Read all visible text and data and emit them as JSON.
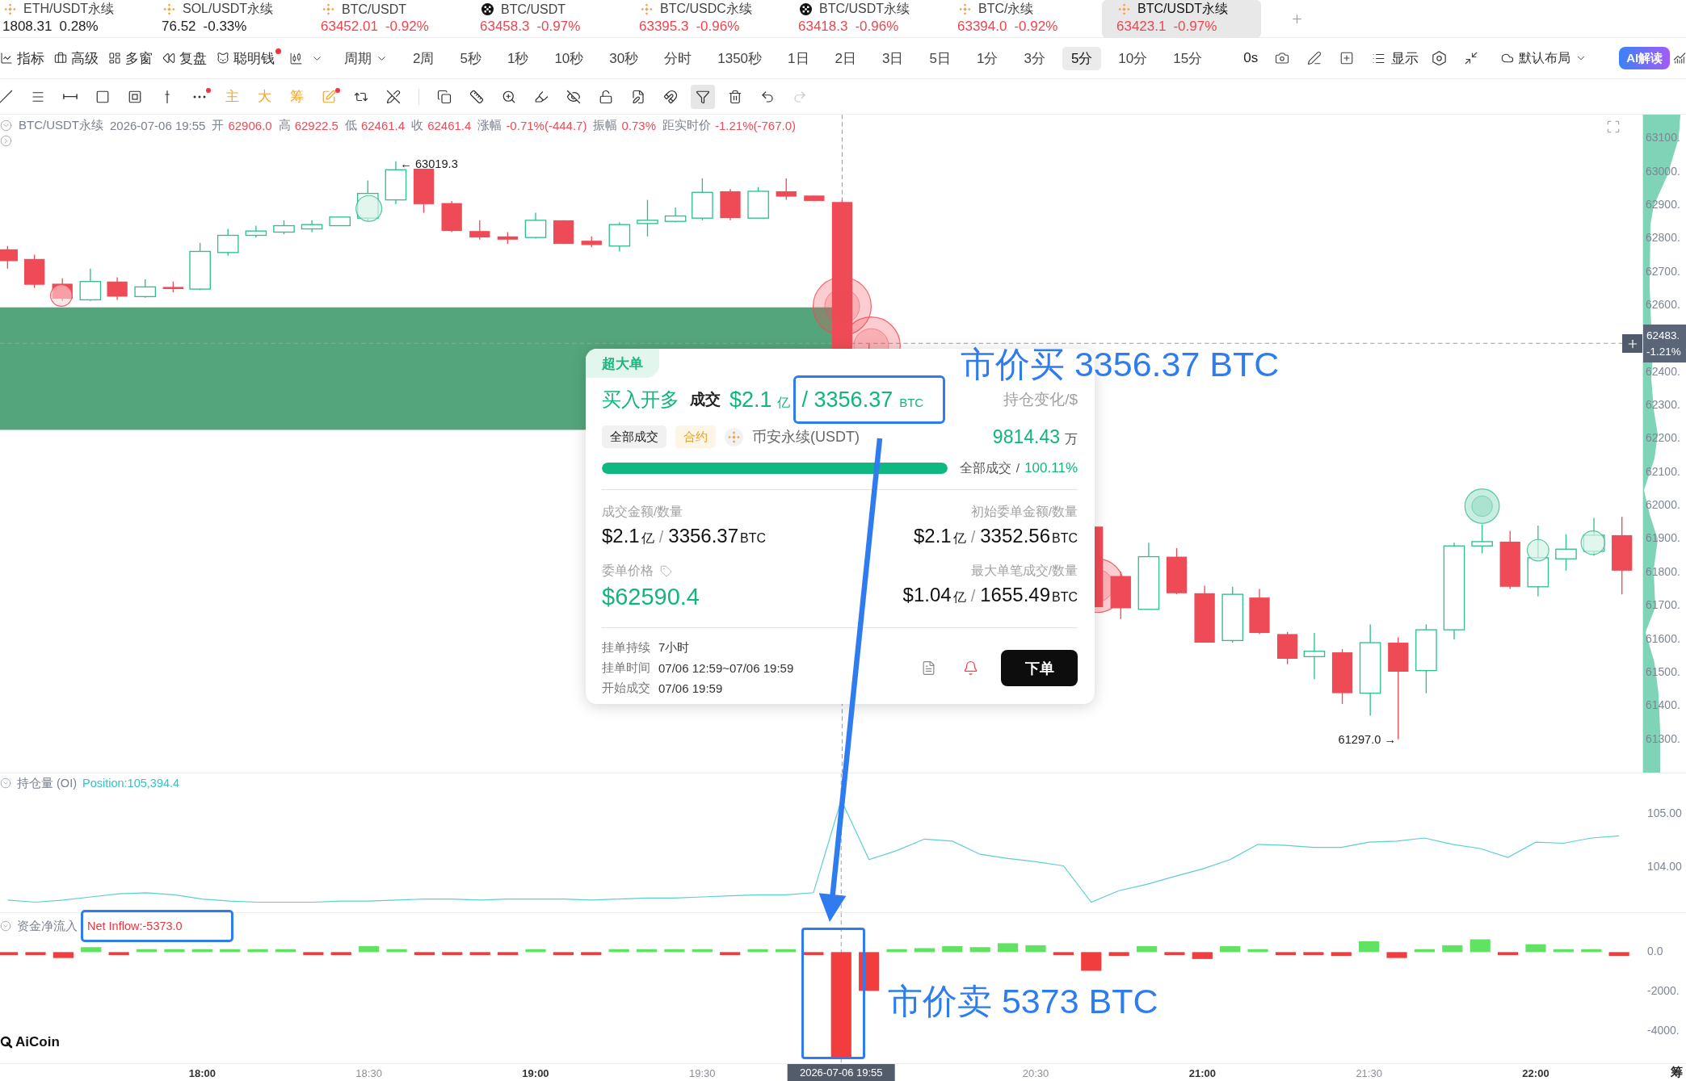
{
  "tickers": [
    {
      "symbol": "ETH/USDT永续",
      "price": "1808.31",
      "change": "0.28%",
      "kind": "diamond",
      "color": "#222222",
      "selected": false
    },
    {
      "symbol": "SOL/USDT永续",
      "price": "76.52",
      "change": "-0.33%",
      "kind": "diamond",
      "color": "#222222",
      "selected": false
    },
    {
      "symbol": "BTC/USDT",
      "price": "63452.01",
      "change": "-0.92%",
      "kind": "diamond",
      "color": "#f0444f",
      "selected": false
    },
    {
      "symbol": "BTC/USDT",
      "price": "63458.3",
      "change": "-0.97%",
      "kind": "checker",
      "color": "#f0444f",
      "selected": false
    },
    {
      "symbol": "BTC/USDC永续",
      "price": "63395.3",
      "change": "-0.96%",
      "kind": "diamond",
      "color": "#f0444f",
      "selected": false
    },
    {
      "symbol": "BTC/USDT永续",
      "price": "63418.3",
      "change": "-0.96%",
      "kind": "checker",
      "color": "#f0444f",
      "selected": false
    },
    {
      "symbol": "BTC/永续",
      "price": "63394.0",
      "change": "-0.92%",
      "kind": "diamond",
      "color": "#f0444f",
      "selected": false
    },
    {
      "symbol": "BTC/USDT永续",
      "price": "63423.1",
      "change": "-0.97%",
      "kind": "diamond",
      "color": "#f0444f",
      "selected": true
    }
  ],
  "toolbar": {
    "items": [
      {
        "label": "指标",
        "dot": false
      },
      {
        "label": "高级",
        "dot": false
      },
      {
        "label": "多窗",
        "dot": false
      },
      {
        "label": "复盘",
        "dot": false
      },
      {
        "label": "聪明钱",
        "dot": true
      }
    ],
    "period_menu": "周期",
    "periods": [
      {
        "label": "2周",
        "selected": false
      },
      {
        "label": "5秒",
        "selected": false
      },
      {
        "label": "1秒",
        "selected": false
      },
      {
        "label": "10秒",
        "selected": false
      },
      {
        "label": "30秒",
        "selected": false
      },
      {
        "label": "分时",
        "selected": false
      },
      {
        "label": "1350秒",
        "selected": false
      },
      {
        "label": "1日",
        "selected": false
      },
      {
        "label": "2日",
        "selected": false
      },
      {
        "label": "3日",
        "selected": false
      },
      {
        "label": "5日",
        "selected": false
      },
      {
        "label": "1分",
        "selected": false
      },
      {
        "label": "3分",
        "selected": false
      },
      {
        "label": "5分",
        "selected": true
      },
      {
        "label": "10分",
        "selected": false
      },
      {
        "label": "15分",
        "selected": false
      }
    ],
    "countdown": "0s",
    "display": "显示",
    "layout": "默认布局",
    "ai_button": "AI解读"
  },
  "drawing_tools": {
    "groups": [
      {
        "items": [
          {
            "kind": "trend-line",
            "selected": false,
            "dot": false,
            "disabled": false
          },
          {
            "kind": "parallel-lines",
            "selected": false,
            "dot": false,
            "disabled": false
          },
          {
            "kind": "horizontal-line",
            "selected": false,
            "dot": false,
            "disabled": false
          },
          {
            "kind": "rectangle",
            "selected": false,
            "dot": false,
            "disabled": false
          },
          {
            "kind": "frame",
            "selected": false,
            "dot": false,
            "disabled": false
          },
          {
            "kind": "vertical-line",
            "selected": false,
            "dot": false,
            "disabled": false
          },
          {
            "kind": "ellipsis",
            "selected": false,
            "dot": true,
            "disabled": false
          },
          {
            "kind": "text",
            "label": "主",
            "selected": false,
            "dot": false,
            "disabled": false
          },
          {
            "kind": "text",
            "label": "大",
            "selected": false,
            "dot": false,
            "disabled": false
          },
          {
            "kind": "text",
            "label": "筹",
            "selected": false,
            "dot": false,
            "disabled": false
          },
          {
            "kind": "pen-square",
            "selected": false,
            "dot": true,
            "disabled": false
          },
          {
            "kind": "repeat",
            "selected": false,
            "dot": false,
            "disabled": false
          },
          {
            "kind": "pen-off",
            "selected": false,
            "dot": false,
            "disabled": false
          }
        ]
      },
      {
        "items": [
          {
            "kind": "copy",
            "selected": false,
            "dot": false,
            "disabled": false
          },
          {
            "kind": "ruler",
            "selected": false,
            "dot": false,
            "disabled": false
          },
          {
            "kind": "zoom-in",
            "selected": false,
            "dot": false,
            "disabled": false
          },
          {
            "kind": "highlighter",
            "selected": false,
            "dot": false,
            "disabled": false
          },
          {
            "kind": "eye-off",
            "selected": false,
            "dot": false,
            "disabled": false
          },
          {
            "kind": "unlock",
            "selected": false,
            "dot": false,
            "disabled": false
          },
          {
            "kind": "file-pen",
            "selected": false,
            "dot": false,
            "disabled": false
          },
          {
            "kind": "magnet",
            "selected": false,
            "dot": false,
            "disabled": false
          },
          {
            "kind": "filter",
            "selected": true,
            "dot": false,
            "disabled": false
          },
          {
            "kind": "trash",
            "selected": false,
            "dot": false,
            "disabled": false
          },
          {
            "kind": "undo",
            "selected": false,
            "dot": false,
            "disabled": false
          },
          {
            "kind": "redo",
            "selected": false,
            "dot": false,
            "disabled": true
          }
        ]
      }
    ]
  },
  "chart": {
    "legend": {
      "symbol": "BTC/USDT永续",
      "time": "2026-07-06 19:55",
      "fields": [
        {
          "label": "开",
          "value": "62906.0"
        },
        {
          "label": "高",
          "value": "62922.5"
        },
        {
          "label": "低",
          "value": "62461.4"
        },
        {
          "label": "收",
          "value": "62461.4"
        },
        {
          "label": "涨幅",
          "value": "-0.71%(-444.7)"
        },
        {
          "label": "振幅",
          "value": "0.73%"
        },
        {
          "label": "距实时价",
          "value": "-1.21%(-767.0)"
        }
      ]
    },
    "high_marker": "← 63019.3",
    "low_marker": "61297.0 →",
    "price_axis": [
      "63100.",
      "63000.",
      "62900.",
      "62800.",
      "62700.",
      "62600.",
      "62400.",
      "62300.",
      "62200.",
      "62100.",
      "62000.",
      "61900.",
      "61800.",
      "61700.",
      "61600.",
      "61500.",
      "61400.",
      "61300."
    ],
    "last_price": {
      "price": "62483.",
      "change": "-1.21%"
    }
  },
  "order_card": {
    "tag": "超大单",
    "side": "买入开多",
    "deal_label": "成交",
    "deal_amount": {
      "value": "$2.1",
      "unit": "亿"
    },
    "deal_quantity": {
      "value": "/ 3356.37",
      "unit": "BTC"
    },
    "position_label": "持仓变化/$",
    "chips": [
      {
        "label": "全部成交",
        "kind": "status"
      },
      {
        "label": "合约",
        "kind": "contract"
      }
    ],
    "exchange": "币安永续(USDT)",
    "position_change": {
      "value": "9814.43",
      "unit": "万"
    },
    "fill": {
      "level": 1,
      "label": "全部成交",
      "separator": "/",
      "percent": "100.11%"
    },
    "stats": [
      {
        "label": "成交金额/数量",
        "kind": "amount",
        "parts": [
          {
            "kind": "number",
            "text": "$2.1"
          },
          {
            "kind": "unit",
            "text": "亿"
          },
          {
            "kind": "slash",
            "text": "/"
          },
          {
            "kind": "number",
            "text": "3356.37"
          },
          {
            "kind": "unit",
            "text": "BTC"
          }
        ]
      },
      {
        "label": "初始委单金额/数量",
        "kind": "amount",
        "parts": [
          {
            "kind": "number",
            "text": "$2.1"
          },
          {
            "kind": "unit",
            "text": "亿"
          },
          {
            "kind": "slash",
            "text": "/"
          },
          {
            "kind": "number",
            "text": "3352.56"
          },
          {
            "kind": "unit",
            "text": "BTC"
          }
        ]
      },
      {
        "label": "委单价格",
        "kind": "price",
        "parts": [
          {
            "kind": "number",
            "text": "$62590.4"
          }
        ]
      },
      {
        "label": "最大单笔成交/数量",
        "kind": "amount",
        "parts": [
          {
            "kind": "number",
            "text": "$1.04"
          },
          {
            "kind": "unit",
            "text": "亿"
          },
          {
            "kind": "slash",
            "text": "/"
          },
          {
            "kind": "number",
            "text": "1655.49"
          },
          {
            "kind": "unit",
            "text": "BTC"
          }
        ]
      }
    ],
    "details": [
      {
        "label": "挂单持续",
        "value": "7小时"
      },
      {
        "label": "挂单时间",
        "value": "07/06 12:59~07/06 19:59"
      },
      {
        "label": "开始成交",
        "value": "07/06 19:59"
      }
    ],
    "order_button": "下单"
  },
  "open_interest": {
    "title": "持仓量 (OI)",
    "reading": ":105,394.4",
    "chart_data": {
      "type": "line",
      "series": [
        {
          "name": "Position",
          "color": "#5ccfcf",
          "values": [
            103.37,
            103.33,
            103.37,
            103.43,
            103.49,
            103.51,
            103.47,
            103.39,
            103.35,
            103.33,
            103.33,
            103.33,
            103.35,
            103.35,
            103.37,
            103.39,
            103.39,
            103.37,
            103.39,
            103.39,
            103.39,
            103.37,
            103.39,
            103.41,
            103.41,
            103.43,
            103.45,
            103.47,
            103.47,
            103.51,
            105.27,
            104.14,
            104.31,
            104.53,
            104.49,
            104.24,
            104.16,
            104.1,
            104.02,
            103.33,
            103.55,
            103.67,
            103.82,
            103.96,
            104.14,
            104.43,
            104.41,
            104.37,
            104.37,
            104.47,
            104.49,
            104.55,
            104.43,
            104.35,
            104.18,
            104.47,
            104.45,
            104.55,
            104.59
          ]
        }
      ],
      "ylim": [
        103.139,
        105.776
      ],
      "yticks": [
        {
          "value": 105,
          "label": "105.00"
        },
        {
          "value": 104,
          "label": "104.00"
        }
      ]
    }
  },
  "net_inflow": {
    "title": "资金净流入",
    "reading": "Net Inflow:-5373.0",
    "chart_data": {
      "type": "bar",
      "values": [
        -150,
        -150,
        -300,
        250,
        -150,
        150,
        150,
        150,
        150,
        150,
        150,
        -150,
        -150,
        300,
        150,
        -150,
        -150,
        -150,
        -150,
        150,
        -150,
        -150,
        150,
        150,
        150,
        150,
        -150,
        150,
        150,
        -150,
        -5373,
        -1970,
        150,
        200,
        300,
        250,
        450,
        350,
        -150,
        -950,
        -200,
        300,
        -150,
        -350,
        300,
        150,
        -150,
        -150,
        -200,
        550,
        -300,
        150,
        350,
        650,
        -150,
        400,
        150,
        150,
        -200
      ],
      "ylim": [
        -5650,
        1984
      ],
      "yticks": [
        {
          "value": 0,
          "label": "0.0"
        },
        {
          "value": -2000,
          "label": "-2000."
        },
        {
          "value": -4000,
          "label": "-4000."
        }
      ]
    }
  },
  "brand": "AiCoin",
  "time_axis": {
    "ticks": [
      {
        "label": "18:00",
        "major": true
      },
      {
        "label": "18:30",
        "major": false
      },
      {
        "label": "19:00",
        "major": true
      },
      {
        "label": "19:30",
        "major": false
      },
      {
        "label": "20:30",
        "major": false
      },
      {
        "label": "21:00",
        "major": true
      },
      {
        "label": "21:30",
        "major": false
      },
      {
        "label": "22:00",
        "major": true
      }
    ],
    "cursor": "2026-07-06 19:55",
    "corner": "筹"
  },
  "annotations": [
    {
      "text": "市价买 3356.37 BTC"
    },
    {
      "text": "市价卖 5373 BTC"
    }
  ]
}
